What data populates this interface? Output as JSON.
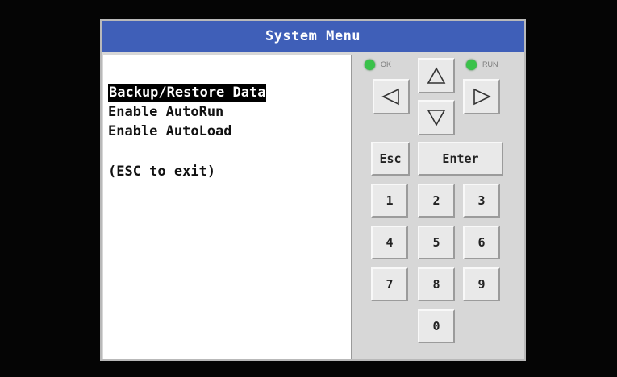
{
  "window": {
    "title": "System Menu"
  },
  "menu": {
    "items": [
      {
        "label": "Backup/Restore Data",
        "selected": true
      },
      {
        "label": "Enable AutoRun",
        "selected": false
      },
      {
        "label": "Enable AutoLoad",
        "selected": false
      }
    ],
    "hint": "(ESC to exit)"
  },
  "indicators": {
    "ok": {
      "label": "OK",
      "color": "#3ac24a"
    },
    "run": {
      "label": "RUN",
      "color": "#3ac24a"
    }
  },
  "keypad": {
    "arrows": {
      "up": "up-arrow-icon",
      "down": "down-arrow-icon",
      "left": "left-arrow-icon",
      "right": "right-arrow-icon"
    },
    "esc_label": "Esc",
    "enter_label": "Enter",
    "digits": [
      "1",
      "2",
      "3",
      "4",
      "5",
      "6",
      "7",
      "8",
      "9",
      "0"
    ]
  },
  "colors": {
    "title_bar": "#3f5fb8",
    "panel": "#d7d7d7",
    "screen": "#ffffff",
    "background": "#000000"
  }
}
